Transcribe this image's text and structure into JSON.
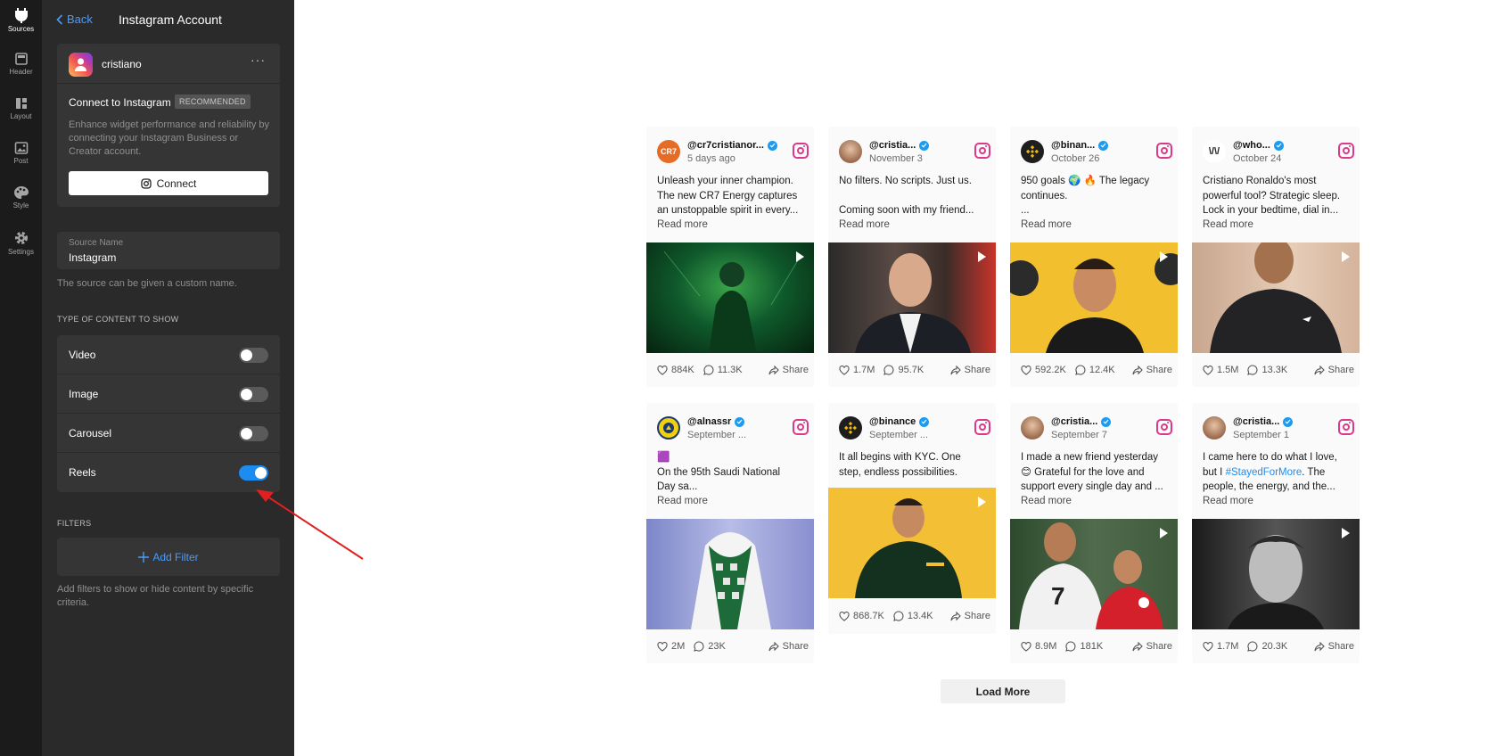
{
  "rail": [
    {
      "label": "Sources",
      "icon": "plug-icon",
      "active": true
    },
    {
      "label": "Header",
      "icon": "header-icon"
    },
    {
      "label": "Layout",
      "icon": "layout-icon"
    },
    {
      "label": "Post",
      "icon": "image-icon"
    },
    {
      "label": "Style",
      "icon": "palette-icon"
    },
    {
      "label": "Settings",
      "icon": "gear-icon"
    }
  ],
  "panel": {
    "back_label": "Back",
    "title": "Instagram Account",
    "account": {
      "name": "cristiano",
      "connect_title": "Connect to Instagram",
      "badge": "RECOMMENDED",
      "description": "Enhance widget performance and reliability by connecting your Instagram Business or Creator account.",
      "connect_button": "Connect"
    },
    "source": {
      "label": "Source Name",
      "value": "Instagram",
      "hint": "The source can be given a custom name."
    },
    "content_section": "TYPE OF CONTENT TO SHOW",
    "toggles": [
      {
        "label": "Video",
        "on": false
      },
      {
        "label": "Image",
        "on": false
      },
      {
        "label": "Carousel",
        "on": false
      },
      {
        "label": "Reels",
        "on": true
      }
    ],
    "filters_section": "FILTERS",
    "add_filter": "Add Filter",
    "filter_hint": "Add filters to show or hide content by specific criteria."
  },
  "feed": {
    "read_more": "Read more",
    "share": "Share",
    "load_more": "Load More",
    "posts": [
      {
        "user": "@cr7cristianor...",
        "date": "5 days ago",
        "lines": [
          "Unleash your inner champion.",
          "The new CR7 Energy captures",
          "an unstoppable spirit in every..."
        ],
        "likes": "884K",
        "comments": "11.3K",
        "avatar": "CR7"
      },
      {
        "user": "@cristia...",
        "date": "November 3",
        "lines": [
          "No filters. No scripts. Just us.",
          "",
          "Coming soon with my friend..."
        ],
        "likes": "1.7M",
        "comments": "95.7K"
      },
      {
        "user": "@binan...",
        "date": "October 26",
        "lines": [
          "950 goals 🌍 🔥 The legacy",
          "continues.",
          "..."
        ],
        "likes": "592.2K",
        "comments": "12.4K"
      },
      {
        "user": "@who...",
        "date": "October 24",
        "lines": [
          "Cristiano Ronaldo's most",
          "powerful tool? Strategic sleep.",
          "Lock in your bedtime, dial in..."
        ],
        "likes": "1.5M",
        "comments": "13.3K"
      },
      {
        "user": "@alnassr",
        "date": "September ...",
        "lines": [
          "🟪",
          "On the 95th Saudi National",
          "Day sa..."
        ],
        "likes": "2M",
        "comments": "23K"
      },
      {
        "user": "@binance",
        "date": "September ...",
        "lines": [
          "It all begins with KYC. One",
          "step, endless possibilities."
        ],
        "likes": "868.7K",
        "comments": "13.4K"
      },
      {
        "user": "@cristia...",
        "date": "September 7",
        "lines": [
          "I made a new friend yesterday",
          "😊 Grateful for the love and",
          "support every single day and ..."
        ],
        "likes": "8.9M",
        "comments": "181K"
      },
      {
        "user": "@cristia...",
        "date": "September 1",
        "lines_pre": "I came here to do what I love,",
        "line2_a": "but I ",
        "line2_tag": "#StayedForMore",
        "line2_b": ". The",
        "line3": "people, the energy, and the...",
        "likes": "1.7M",
        "comments": "20.3K"
      }
    ]
  },
  "colors": {
    "accent": "#1c8cf0",
    "panel_bg": "#2a2a2a",
    "rail_bg": "#1b1b1b",
    "instagram_pink": "#d93a8a",
    "arrow_red": "#e02020"
  }
}
